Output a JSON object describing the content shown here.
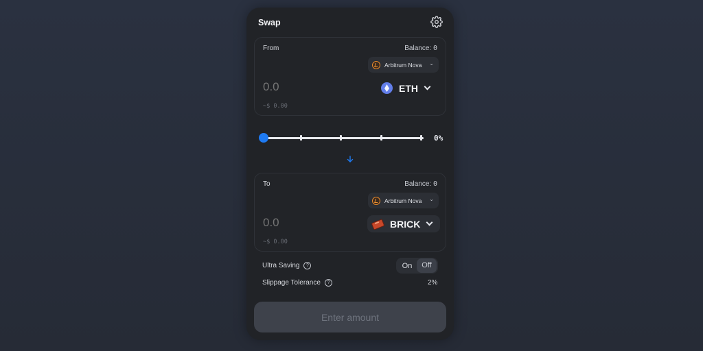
{
  "header": {
    "title": "Swap",
    "settings_icon": "gear-icon"
  },
  "from_panel": {
    "label": "From",
    "balance_label": "Balance:",
    "balance_value": "0",
    "chain": {
      "name": "Arbitrum Nova",
      "icon": "arbitrum-nova-icon"
    },
    "amount_placeholder": "0.0",
    "usd_value": "~$ 0.00",
    "token": {
      "symbol": "ETH",
      "icon": "eth-icon"
    }
  },
  "slider": {
    "value_percent": 0,
    "label": "0%",
    "marks": [
      0,
      25,
      50,
      75,
      100
    ]
  },
  "switch_icon": "arrow-down-icon",
  "to_panel": {
    "label": "To",
    "balance_label": "Balance:",
    "balance_value": "0",
    "chain": {
      "name": "Arbitrum Nova",
      "icon": "arbitrum-nova-icon"
    },
    "amount_placeholder": "0.0",
    "usd_value": "~$ 0.00",
    "token": {
      "symbol": "BRICK",
      "icon": "brick-icon"
    }
  },
  "options": {
    "ultra_saving": {
      "label": "Ultra Saving",
      "on_label": "On",
      "off_label": "Off",
      "selected": "Off"
    },
    "slippage": {
      "label": "Slippage Tolerance",
      "value": "2%"
    }
  },
  "cta": {
    "label": "Enter amount"
  },
  "colors": {
    "accent": "#1e7af2",
    "card": "#212327",
    "background": "#262b36"
  }
}
